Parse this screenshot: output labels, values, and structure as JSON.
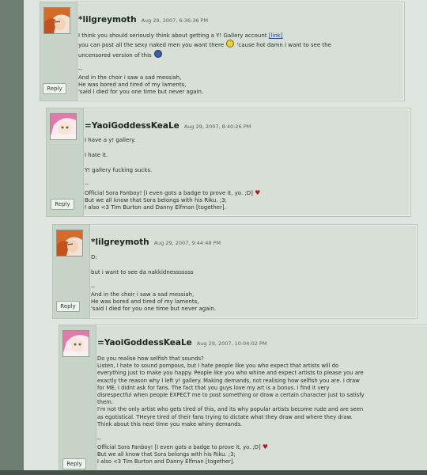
{
  "comments": [
    {
      "sym": "*",
      "username": "lilgreymoth",
      "date": "Aug 29, 2007, 6:36:36 PM",
      "reply_label": "Reply",
      "line1a": "I think you should seriously think about getting a Y! Gallery account",
      "link_label": "[link]",
      "line2a": "you can post all the sexy naked men you want there",
      "line2b": "'cause hot damn i want to see the",
      "line3": "uncensored version of this",
      "sig": [
        "--",
        "And in the choir i saw a sad messiah,",
        "He was bored and tired of my laments,",
        "'said I died for you one time but never again."
      ]
    },
    {
      "sym": "=",
      "username": "YaoiGoddessKeaLe",
      "date": "Aug 29, 2007, 8:40:26 PM",
      "reply_label": "Reply",
      "lines": [
        "I have a y! gallery.",
        "I hate it.",
        "Y! gallery fucking sucks."
      ],
      "sig_dash": "--",
      "sig1": "Official Sora Fanboy! [I even gots a badge to prove it, yo. ;D]",
      "sig2": "But we all know that Sora belongs with his Riku. ;3;",
      "sig3": "I also <3 Tim Burton and Danny Elfman [together]."
    },
    {
      "sym": "*",
      "username": "lilgreymoth",
      "date": "Aug 29, 2007, 9:44:48 PM",
      "reply_label": "Reply",
      "lines": [
        "D:",
        "but i want to see da nakkidnesssssss"
      ],
      "sig": [
        "--",
        "And in the choir i saw a sad messiah,",
        "He was bored and tired of my laments,",
        "'said I died for you one time but never again."
      ]
    },
    {
      "sym": "=",
      "username": "YaoiGoddessKeaLe",
      "date": "Aug 29, 2007, 10:04:02 PM",
      "reply_label": "Reply",
      "para": [
        "Do you realise how selfish that sounds?",
        "Listen, I hate to sound pompous, but I hate people like you who expect that artists will do",
        "everything just to make you happy. People like you who whine and expect artists to please you are",
        "exactly the reason why I left y! gallery. Making demands, not realising how selfish you are. I draw",
        "for ME, I didnt ask for fans. The fact that you guys love my art is a bonus. I find it very",
        "disrespectful when people EXPECT me to post something or draw a certain character just to satisfy",
        "them.",
        "I'm not the only artist who gets tired of this, and its why popular artists become rude and are seen",
        "as egotistical. THeyre tired of their fans trying to dictate what they draw and where they draw.",
        "Think about this next time you make whiny demands."
      ],
      "sig_dash": "--",
      "sig1": "Official Sora Fanboy! [I even gots a badge to prove it, yo. ;D]",
      "sig2": "But we all know that Sora belongs with his Riku. ;3;",
      "sig3": "I also <3 Tim Burton and Danny Elfman [together]."
    }
  ],
  "colors": {
    "accent": "#24448a",
    "heart": "#b01f1f",
    "panel": "#d7dfd6"
  },
  "icons": {
    "smiley_tongue": "smiley-tongue-icon",
    "smiley_blush": "smiley-blush-icon",
    "heart": "heart-icon"
  }
}
